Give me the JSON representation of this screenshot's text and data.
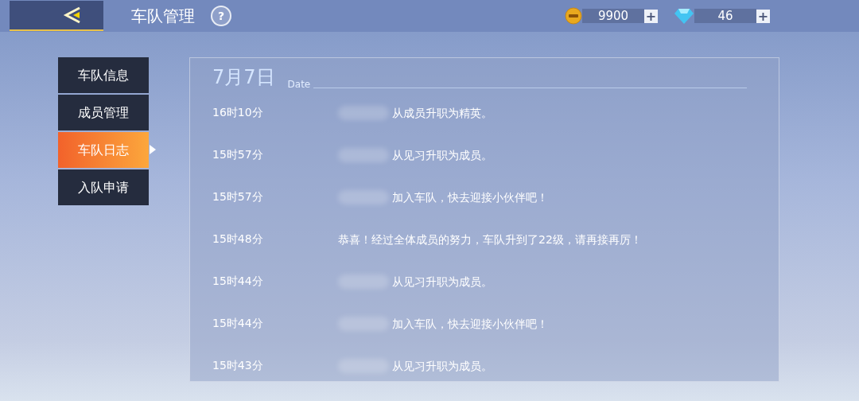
{
  "header": {
    "title": "车队管理",
    "help": "?"
  },
  "currencies": [
    {
      "kind": "coin",
      "amount": "9900",
      "plus": "+"
    },
    {
      "kind": "diamond",
      "amount": "46",
      "plus": "+"
    }
  ],
  "tabs": [
    {
      "label": "车队信息",
      "selected": false
    },
    {
      "label": "成员管理",
      "selected": false
    },
    {
      "label": "车队日志",
      "selected": true
    },
    {
      "label": "入队申请",
      "selected": false
    }
  ],
  "log": {
    "date": "7月7日",
    "date_label": "Date",
    "entries": [
      {
        "time": "16时10分",
        "name_hidden": true,
        "message": "从成员升职为精英。"
      },
      {
        "time": "15时57分",
        "name_hidden": true,
        "message": "从见习升职为成员。"
      },
      {
        "time": "15时57分",
        "name_hidden": true,
        "message": "加入车队，快去迎接小伙伴吧！"
      },
      {
        "time": "15时48分",
        "name_hidden": false,
        "message": "恭喜！经过全体成员的努力，车队升到了22级，请再接再厉！"
      },
      {
        "time": "15时44分",
        "name_hidden": true,
        "message": "从见习升职为成员。"
      },
      {
        "time": "15时44分",
        "name_hidden": true,
        "message": "加入车队，快去迎接小伙伴吧！"
      },
      {
        "time": "15时43分",
        "name_hidden": true,
        "message": "从见习升职为成员。"
      }
    ]
  }
}
